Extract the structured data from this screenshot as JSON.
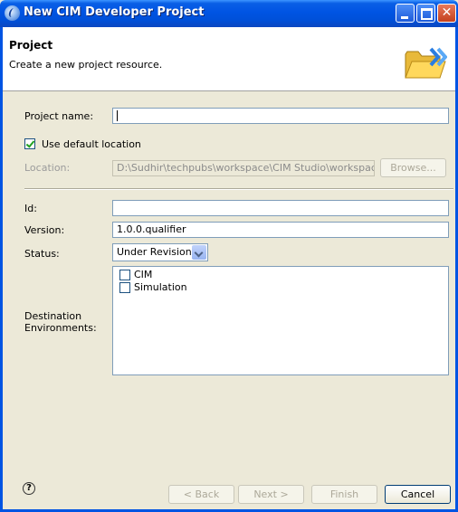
{
  "window": {
    "title": "New CIM Developer Project"
  },
  "banner": {
    "title": "Project",
    "description": "Create a new project resource."
  },
  "form": {
    "project_name_label": "Project name:",
    "project_name_value": "",
    "use_default_location_label": "Use default location",
    "use_default_location_checked": true,
    "location_label": "Location:",
    "location_value": "D:\\Sudhir\\techpubs\\workspace\\CIM Studio\\workspace\\VS",
    "browse_label": "Browse...",
    "id_label": "Id:",
    "id_value": "",
    "version_label": "Version:",
    "version_value": "1.0.0.qualifier",
    "status_label": "Status:",
    "status_value": "Under Revision",
    "destination_label_line1": "Destination",
    "destination_label_line2": "Environments:",
    "environments": [
      {
        "label": "CIM",
        "checked": false
      },
      {
        "label": "Simulation",
        "checked": false
      }
    ]
  },
  "buttons": {
    "help": "?",
    "back": "< Back",
    "next": "Next >",
    "finish": "Finish",
    "cancel": "Cancel"
  },
  "colors": {
    "titlebar": "#0054e3",
    "dialog_bg": "#ece9d8",
    "field_border": "#7f9db9"
  }
}
